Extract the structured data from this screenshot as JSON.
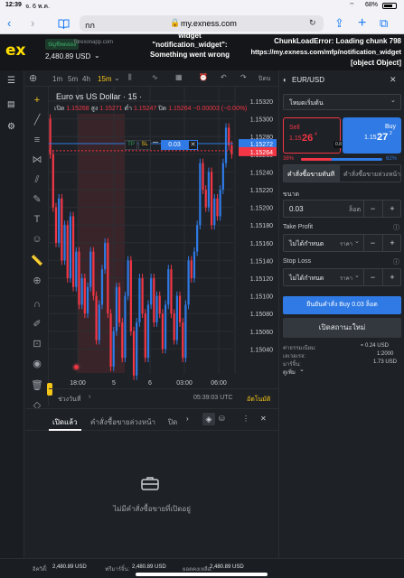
{
  "status_bar": {
    "time": "12:39",
    "date": "จ. 6 พ.ค.",
    "battery": "68%"
  },
  "safari": {
    "tab_text": "กก",
    "url": "my.exness.com"
  },
  "header": {
    "logo": "ex",
    "account_badge": "บัญชีทดลอง",
    "account_domain": "forexonapp.com",
    "balance": "2,480.89 USD",
    "error_widget_top": "widget",
    "error_widget": "\"notification_widget\": Something went wrong",
    "error_chunk": "ChunkLoadError: Loading chunk 798",
    "error_url": "https://my.exness.com/mfp/notification_widget",
    "error_obj": "[object Object]"
  },
  "chart_toolbar": {
    "timeframes": [
      "1m",
      "5m",
      "4h",
      "15m"
    ],
    "active": "15m",
    "right_label": "ปิดบ"
  },
  "chart": {
    "symbol_title": "Euro vs US Dollar · 15 ·",
    "ohlc": {
      "open_label": "เปิด",
      "open": "1.15268",
      "high_label": "สูง",
      "high": "1.15271",
      "low_label": "ต่ำ",
      "low": "1.15247",
      "close_label": "ปิด",
      "close": "1.15264",
      "change": "−0.00003 (−0.00%)"
    },
    "tp_label": "TP",
    "sl_label": "SL",
    "qty_label": "0.03",
    "price_ticks": [
      "1.15320",
      "1.15300",
      "1.15280",
      "1.15260",
      "1.15240",
      "1.15220",
      "1.15200",
      "1.15180",
      "1.15160",
      "1.15140",
      "1.15120",
      "1.15100",
      "1.15080",
      "1.15060",
      "1.15040"
    ],
    "ask_badge": "1.15272",
    "bid_badge": "1.15264",
    "time_ticks": [
      "18:00",
      "5",
      "6",
      "03:00",
      "06:00"
    ],
    "range_label": "ช่วงวันที่",
    "clock": "05:39:03 UTC",
    "auto_label": "อัตโนมัติ",
    "colors": {
      "up": "#2f7ae5",
      "down": "#f23645",
      "shade": "#5a2a2f"
    }
  },
  "orders": {
    "tabs": [
      "เปิดแล้ว",
      "คำสั่งซื้อขายล่วงหน้า",
      "ปิด"
    ],
    "empty_text": "ไม่มีคำสั่งซื้อขายที่เปิดอยู่"
  },
  "trade_panel": {
    "symbol": "EUR/USD",
    "mode": "โหมดเริ่มต้น",
    "sell_label": "Sell",
    "sell_price_main": "1.15",
    "sell_price_big": "26",
    "sell_price_sup": "4",
    "spread": "0.8",
    "buy_label": "Buy",
    "buy_price_main": "1.15",
    "buy_price_big": "27",
    "buy_price_sup": "2",
    "sell_pct": "38%",
    "buy_pct": "62%",
    "tab_market": "คำสั่งซื้อขายทันที",
    "tab_pending": "คำสั่งซื้อขายล่วงหน้า",
    "volume_label": "ขนาด",
    "volume_value": "0.03",
    "volume_unit": "ล็อต",
    "tp_label": "Take Profit",
    "tp_value": "ไม่ได้กำหนด",
    "tp_unit": "ราคา",
    "sl_label": "Stop Loss",
    "sl_value": "ไม่ได้กำหนด",
    "sl_unit": "ราคา",
    "confirm_button": "ยืนยันคำสั่ง Buy 0.03 ล็อต",
    "cancel_button": "เปิดสถานะใหม่",
    "fee_label": "ค่าธรรมเนียม:",
    "fee_value": "≈ 0.24 USD",
    "leverage_label": "เลเวอเรจ:",
    "leverage_value": "1:2000",
    "margin_label": "มาร์จิ้น:",
    "margin_value": "1.73 USD",
    "more_label": "ดูเพิ่ม"
  },
  "footer": {
    "equity_label": "อิควิตี้:",
    "equity_value": "2,480.89 USD",
    "free_margin_label": "ฟรีมาร์จิ้น:",
    "free_margin_value": "2,480.89 USD",
    "balance_label": "ยอดคงเหลือ:",
    "balance_value": "2,480.89 USD"
  }
}
